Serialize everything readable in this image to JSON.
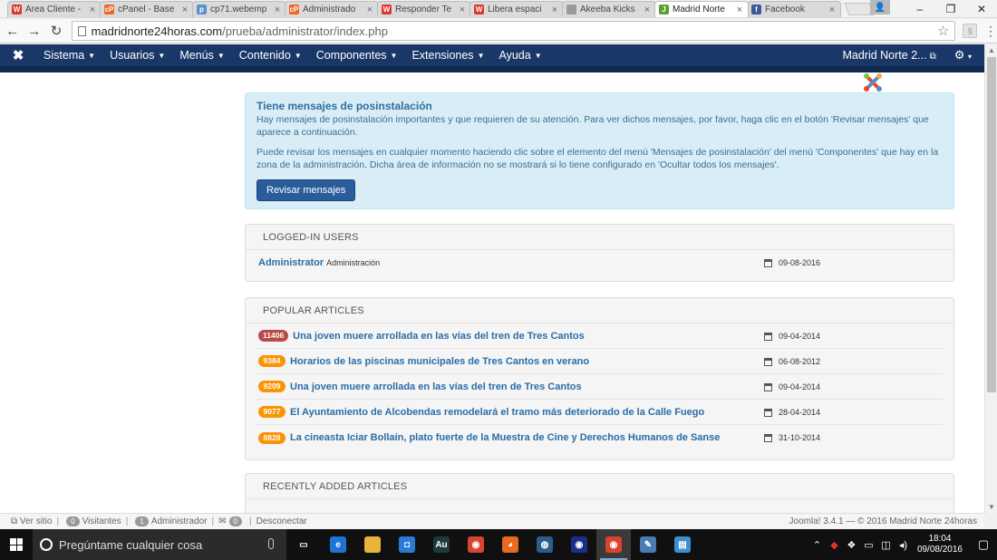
{
  "browser": {
    "tabs": [
      {
        "label": "Área Cliente -",
        "fav_color": "#e0342c",
        "fav_text": "W"
      },
      {
        "label": "cPanel - Base",
        "fav_color": "#f26522",
        "fav_text": "cP"
      },
      {
        "label": "cp71.webemp",
        "fav_color": "#5f8fc9",
        "fav_text": "p"
      },
      {
        "label": "Administrado",
        "fav_color": "#f26522",
        "fav_text": "cP"
      },
      {
        "label": "Responder Te",
        "fav_color": "#e0342c",
        "fav_text": "W"
      },
      {
        "label": "Libera espaci",
        "fav_color": "#e0342c",
        "fav_text": "W"
      },
      {
        "label": "Akeeba Kicks",
        "fav_color": "#9a9a9a",
        "fav_text": ""
      },
      {
        "label": "Madrid Norte",
        "fav_color": "#5aa02c",
        "fav_text": "J"
      },
      {
        "label": "Facebook",
        "fav_color": "#3b5998",
        "fav_text": "f"
      }
    ],
    "active_tab_index": 7,
    "tab_close_glyph": "×",
    "url_domain": "madridnorte24horas.com",
    "url_path": "/prueba/administrator/index.php",
    "window_controls": [
      "–",
      "❐",
      "✕"
    ]
  },
  "navbar": {
    "logo_icon": "joomla-icon",
    "menus": [
      "Sistema",
      "Usuarios",
      "Menús",
      "Contenido",
      "Componentes",
      "Extensiones",
      "Ayuda"
    ],
    "site_name": "Madrid Norte 2...",
    "bg_color": "#1a3867"
  },
  "alert": {
    "title": "Tiene mensajes de posinstalación",
    "paragraph1": "Hay mensajes de posinstalación importantes y que requieren de su atención. Para ver dichos mensajes, por favor, haga clic en el botón 'Revisar mensajes' que aparece a continuación.",
    "paragraph2": "Puede revisar los mensajes en cualquier momento haciendo clic sobre el elemento del menú 'Mensajes de posinstalación' del menú 'Componentes' que hay en la zona de la administración. Dicha área de información no se mostrará si lo tiene configurado en 'Ocultar todos los mensajes'.",
    "button": "Revisar mensajes"
  },
  "logged_in": {
    "heading": "LOGGED-IN USERS",
    "users": [
      {
        "name": "Administrator",
        "area": "Administración",
        "date": "09-08-2016"
      }
    ]
  },
  "popular": {
    "heading": "POPULAR ARTICLES",
    "articles": [
      {
        "hits": "11406",
        "level": "important",
        "title": "Una joven muere arrollada en las vías del tren de Tres Cantos",
        "date": "09-04-2014"
      },
      {
        "hits": "9384",
        "level": "warning",
        "title": "Horarios de las piscinas municipales de Tres Cantos en verano",
        "date": "06-08-2012"
      },
      {
        "hits": "9209",
        "level": "warning",
        "title": "Una joven muere arrollada en las vías del tren de Tres Cantos",
        "date": "09-04-2014"
      },
      {
        "hits": "9077",
        "level": "warning",
        "title": "El Ayuntamiento de Alcobendas remodelará el tramo más deteriorado de la Calle Fuego",
        "date": "28-04-2014"
      },
      {
        "hits": "8828",
        "level": "warning",
        "title": "La cineasta Iciar Bollaín, plato fuerte de la Muestra de Cine y Derechos Humanos de Sanse",
        "date": "31-10-2014"
      }
    ]
  },
  "recent": {
    "heading": "RECENTLY ADDED ARTICLES"
  },
  "status": {
    "view_site": "Ver sitio",
    "visitors_count": "0",
    "visitors_label": "Visitantes",
    "admins_count": "1",
    "admins_label": "Administrador",
    "messages_count": "0",
    "logout": "Desconectar",
    "copyright": "Joomla! 3.4.1 — © 2016 Madrid Norte 24horas"
  },
  "taskbar": {
    "search_placeholder": "Pregúntame cualquier cosa",
    "apps": [
      {
        "name": "task-view-icon",
        "color": "#101010",
        "text": "▭",
        "open": false
      },
      {
        "name": "edge-icon",
        "color": "#1e74d6",
        "text": "e",
        "open": false
      },
      {
        "name": "file-explorer-icon",
        "color": "#e8b43a",
        "text": "",
        "open": false
      },
      {
        "name": "store-icon",
        "color": "#2a7ad6",
        "text": "◘",
        "open": false
      },
      {
        "name": "audition-icon",
        "color": "#1b3a3a",
        "text": "Au",
        "open": false
      },
      {
        "name": "chrome-icon",
        "color": "#d9442e",
        "text": "◉",
        "open": false
      },
      {
        "name": "firefox-icon",
        "color": "#e66a1f",
        "text": "◕",
        "open": false
      },
      {
        "name": "network-app-icon",
        "color": "#2b5d8c",
        "text": "◍",
        "open": false
      },
      {
        "name": "firefox-dev-icon",
        "color": "#1a2f8a",
        "text": "◉",
        "open": false
      },
      {
        "name": "chrome-active-icon",
        "color": "#d9442e",
        "text": "◉",
        "open": true
      },
      {
        "name": "paint-icon",
        "color": "#4a7bb3",
        "text": "✎",
        "open": false
      },
      {
        "name": "notes-icon",
        "color": "#3c8fd1",
        "text": "▤",
        "open": false
      }
    ],
    "time": "18:04",
    "date": "09/08/2016"
  }
}
